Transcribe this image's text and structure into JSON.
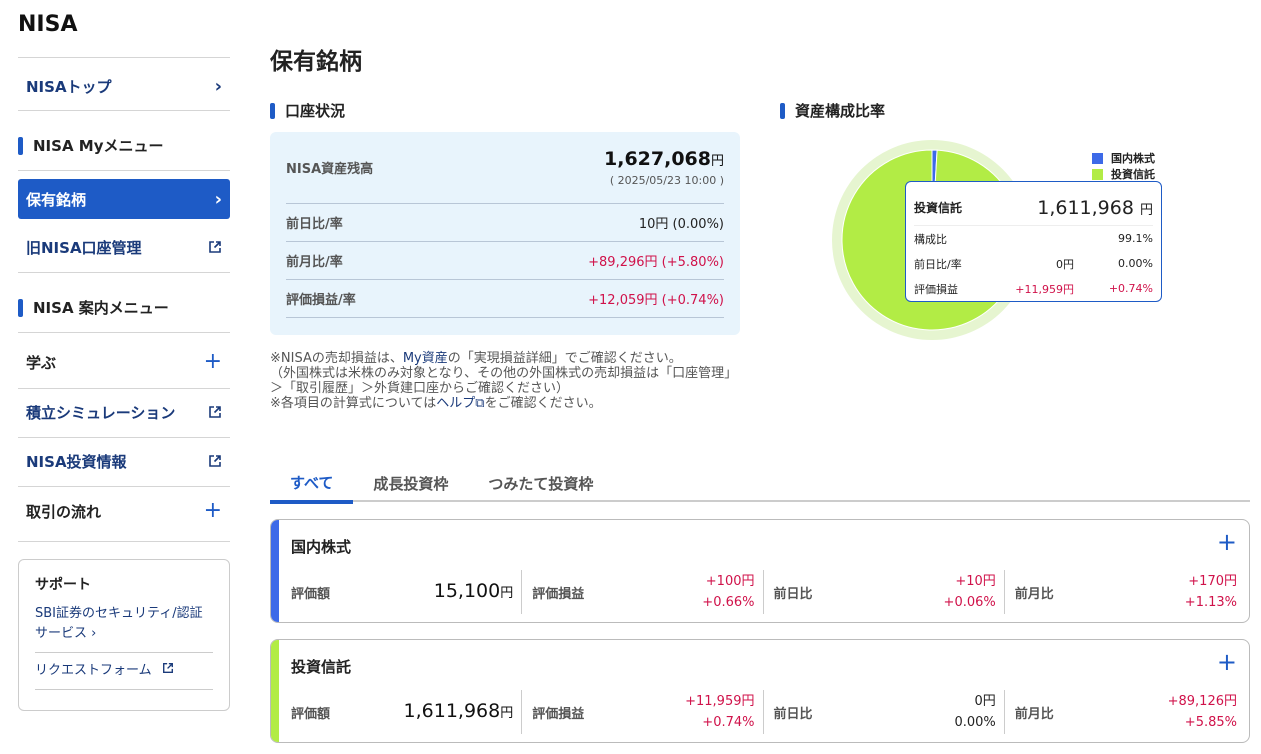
{
  "app_title": "NISA",
  "sidebar": {
    "items": [
      {
        "label": "NISAトップ"
      },
      {
        "section": "NISA Myメニュー"
      },
      {
        "label": "保有銘柄"
      },
      {
        "label": "旧NISA口座管理"
      },
      {
        "section": "NISA 案内メニュー"
      },
      {
        "label": "学ぶ"
      },
      {
        "label": "積立シミュレーション"
      },
      {
        "label": "NISA投資情報"
      },
      {
        "label": "取引の流れ"
      }
    ],
    "support": {
      "title": "サポート",
      "links": [
        "SBI証券のセキュリティ/認証サービス",
        "リクエストフォーム"
      ]
    }
  },
  "main": {
    "title": "保有銘柄",
    "account_section": "口座状況",
    "allocation_section": "資産構成比率",
    "account": {
      "balance_label": "NISA資産残高",
      "balance_value": "1,627,068",
      "yen": "円",
      "timestamp": "( 2025/05/23 10:00 )",
      "rows": [
        {
          "label": "前日比/率",
          "value": "10円 (0.00%)"
        },
        {
          "label": "前月比/率",
          "value": "+89,296円 (+5.80%)"
        },
        {
          "label": "評価損益/率",
          "value": "+12,059円 (+0.74%)"
        }
      ]
    },
    "notes": {
      "line1a": "※NISAの売却損益は、",
      "line1_link": "My資産",
      "line1b": "の「実現損益詳細」でご確認ください。",
      "line2": "（外国株式は米株のみ対象となり、その他の外国株式の売却損益は「口座管理」＞「取引履歴」＞外貨建口座からご確認ください）",
      "line3a": "※各項目の計算式については",
      "line3_link": "ヘルプ",
      "line3b": "をご確認ください。"
    },
    "legend": [
      {
        "label": "国内株式",
        "color": "#3d6ae8"
      },
      {
        "label": "投資信託",
        "color": "#b2ec45"
      }
    ],
    "tooltip": {
      "name": "投資信託",
      "value": "1,611,968",
      "yen": "円",
      "rows": [
        {
          "label": "構成比",
          "v1": "",
          "v2": "99.1%"
        },
        {
          "label": "前日比/率",
          "v1": "0円",
          "v2": "0.00%"
        },
        {
          "label": "評価損益",
          "v1": "+11,959円",
          "v2": "+0.74%"
        }
      ]
    },
    "allocation": {
      "domestic_stock_pct": 0.9,
      "mutual_fund_pct": 99.1
    },
    "tabs": [
      "すべて",
      "成長投資枠",
      "つみたて投資枠"
    ],
    "holdings": [
      {
        "name": "国内株式",
        "color": "#3d6ae8",
        "eval_label": "評価額",
        "eval_value": "15,100",
        "yen": "円",
        "pl_label": "評価損益",
        "pl_amount": "+100円",
        "pl_pct": "+0.66%",
        "day_label": "前日比",
        "day_amount": "+10円",
        "day_pct": "+0.06%",
        "month_label": "前月比",
        "month_amount": "+170円",
        "month_pct": "+1.13%"
      },
      {
        "name": "投資信託",
        "color": "#b2ec45",
        "eval_label": "評価額",
        "eval_value": "1,611,968",
        "yen": "円",
        "pl_label": "評価損益",
        "pl_amount": "+11,959円",
        "pl_pct": "+0.74%",
        "day_label": "前日比",
        "day_amount": "0円",
        "day_pct": "0.00%",
        "month_label": "前月比",
        "month_amount": "+89,126円",
        "month_pct": "+5.85%"
      }
    ]
  }
}
